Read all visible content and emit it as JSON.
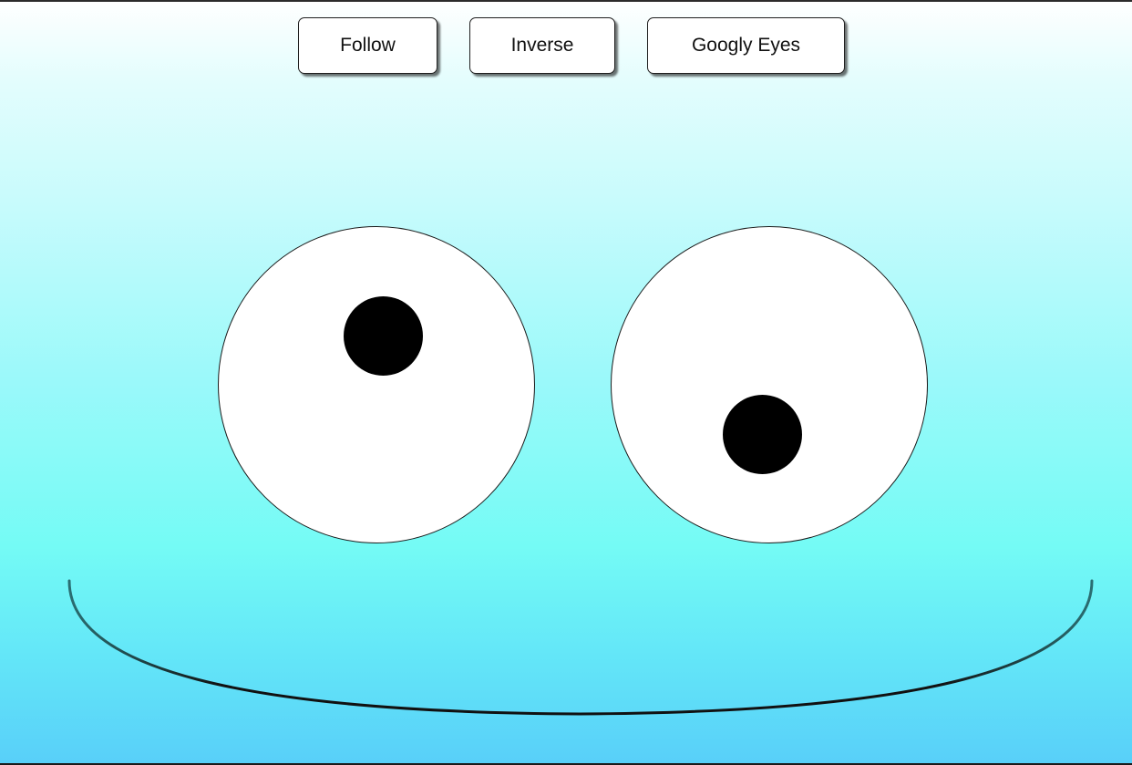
{
  "toolbar": {
    "buttons": [
      {
        "label": "Follow"
      },
      {
        "label": "Inverse"
      },
      {
        "label": "Googly Eyes"
      }
    ]
  },
  "face": {
    "eyes": [
      {
        "name": "left",
        "pupil_direction": "up-right"
      },
      {
        "name": "right",
        "pupil_direction": "down-left"
      }
    ],
    "mouth": "smile"
  },
  "colors": {
    "background_top": "#ffffff",
    "background_mid": "#9af9fa",
    "background_bottom": "#58cff9",
    "eye_white": "#ffffff",
    "pupil": "#000000",
    "button_bg": "#ffffff",
    "outline": "#1a1a1a"
  }
}
